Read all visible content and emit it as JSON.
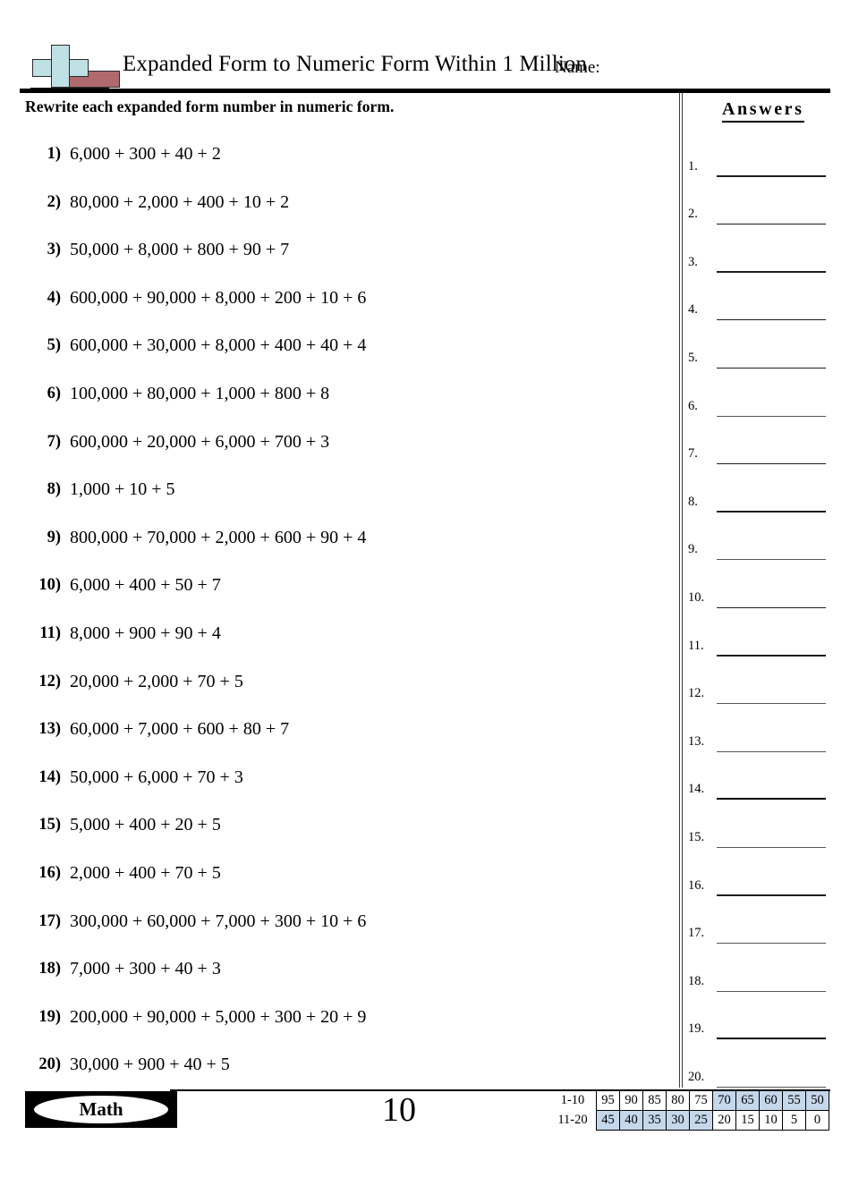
{
  "header": {
    "title": "Expanded Form to Numeric Form Within 1 Million",
    "name_label": "Name:",
    "logo_name": "math-plus-minus-logo"
  },
  "directions": "Rewrite each expanded form number in numeric form.",
  "problems": [
    {
      "num": "1)",
      "expr": "6,000 + 300 + 40 + 2"
    },
    {
      "num": "2)",
      "expr": "80,000 + 2,000 + 400 + 10 + 2"
    },
    {
      "num": "3)",
      "expr": "50,000 + 8,000 + 800 + 90 + 7"
    },
    {
      "num": "4)",
      "expr": "600,000 + 90,000 + 8,000 + 200 + 10 + 6"
    },
    {
      "num": "5)",
      "expr": "600,000 + 30,000 + 8,000 + 400 + 40 + 4"
    },
    {
      "num": "6)",
      "expr": "100,000 + 80,000 + 1,000 + 800 + 8"
    },
    {
      "num": "7)",
      "expr": "600,000 + 20,000 + 6,000 + 700 + 3"
    },
    {
      "num": "8)",
      "expr": "1,000 + 10 + 5"
    },
    {
      "num": "9)",
      "expr": "800,000 + 70,000 + 2,000 + 600 + 90 + 4"
    },
    {
      "num": "10)",
      "expr": "6,000 + 400 + 50 + 7"
    },
    {
      "num": "11)",
      "expr": "8,000 + 900 + 90 + 4"
    },
    {
      "num": "12)",
      "expr": "20,000 + 2,000 + 70 + 5"
    },
    {
      "num": "13)",
      "expr": "60,000 + 7,000 + 600 + 80 + 7"
    },
    {
      "num": "14)",
      "expr": "50,000 + 6,000 + 70 + 3"
    },
    {
      "num": "15)",
      "expr": "5,000 + 400 + 20 + 5"
    },
    {
      "num": "16)",
      "expr": "2,000 + 400 + 70 + 5"
    },
    {
      "num": "17)",
      "expr": "300,000 + 60,000 + 7,000 + 300 + 10 + 6"
    },
    {
      "num": "18)",
      "expr": "7,000 + 300 + 40 + 3"
    },
    {
      "num": "19)",
      "expr": "200,000 + 90,000 + 5,000 + 300 + 20 + 9"
    },
    {
      "num": "20)",
      "expr": "30,000 + 900 + 40 + 5"
    }
  ],
  "answers": {
    "title": "Answers",
    "items": [
      {
        "num": "1.",
        "value": ""
      },
      {
        "num": "2.",
        "value": ""
      },
      {
        "num": "3.",
        "value": ""
      },
      {
        "num": "4.",
        "value": ""
      },
      {
        "num": "5.",
        "value": ""
      },
      {
        "num": "6.",
        "value": ""
      },
      {
        "num": "7.",
        "value": ""
      },
      {
        "num": "8.",
        "value": ""
      },
      {
        "num": "9.",
        "value": ""
      },
      {
        "num": "10.",
        "value": ""
      },
      {
        "num": "11.",
        "value": ""
      },
      {
        "num": "12.",
        "value": ""
      },
      {
        "num": "13.",
        "value": ""
      },
      {
        "num": "14.",
        "value": ""
      },
      {
        "num": "15.",
        "value": ""
      },
      {
        "num": "16.",
        "value": ""
      },
      {
        "num": "17.",
        "value": ""
      },
      {
        "num": "18.",
        "value": ""
      },
      {
        "num": "19.",
        "value": ""
      },
      {
        "num": "20.",
        "value": ""
      }
    ]
  },
  "footer": {
    "brand_label": "Math",
    "page_number": "10"
  },
  "score_table": {
    "rows": [
      {
        "label": "1-10",
        "cells": [
          {
            "value": "95",
            "highlighted": false
          },
          {
            "value": "90",
            "highlighted": false
          },
          {
            "value": "85",
            "highlighted": false
          },
          {
            "value": "80",
            "highlighted": false
          },
          {
            "value": "75",
            "highlighted": false
          },
          {
            "value": "70",
            "highlighted": true
          },
          {
            "value": "65",
            "highlighted": true
          },
          {
            "value": "60",
            "highlighted": true
          },
          {
            "value": "55",
            "highlighted": true
          },
          {
            "value": "50",
            "highlighted": true
          }
        ]
      },
      {
        "label": "11-20",
        "cells": [
          {
            "value": "45",
            "highlighted": true
          },
          {
            "value": "40",
            "highlighted": true
          },
          {
            "value": "35",
            "highlighted": true
          },
          {
            "value": "30",
            "highlighted": true
          },
          {
            "value": "25",
            "highlighted": true
          },
          {
            "value": "20",
            "highlighted": false
          },
          {
            "value": "15",
            "highlighted": false
          },
          {
            "value": "10",
            "highlighted": false
          },
          {
            "value": "5",
            "highlighted": false
          },
          {
            "value": "0",
            "highlighted": false
          }
        ]
      }
    ],
    "highlight_color": "#c5d7ea"
  }
}
